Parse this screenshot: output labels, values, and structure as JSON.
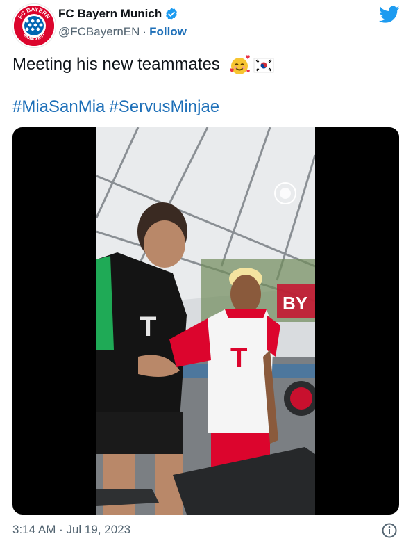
{
  "tweet": {
    "author": {
      "display_name": "FC Bayern Munich",
      "handle": "@FCBayernEN",
      "separator": "·",
      "follow_label": "Follow",
      "avatar_text_top": "FC BAYERN",
      "avatar_text_bottom": "MÜNCHEN",
      "verified_icon": "verified-badge-icon"
    },
    "text": "Meeting his new teammates",
    "emojis": [
      "smiling-face-with-hearts-emoji",
      "south-korea-flag-emoji"
    ],
    "hashtags": [
      "#MiaSanMia",
      "#ServusMinjae"
    ],
    "timestamp": "3:14 AM · Jul 19, 2023",
    "media": {
      "type": "video",
      "watermark_icon": "fc-bayern-logo-watermark",
      "background_sign": "BY"
    }
  },
  "colors": {
    "brand_red": "#dc052d",
    "link_blue": "#1d6fb8",
    "twitter_blue": "#1d9bf0",
    "muted_text": "#536471"
  },
  "icons": {
    "logo": "twitter-bird-icon",
    "info": "info-icon"
  }
}
